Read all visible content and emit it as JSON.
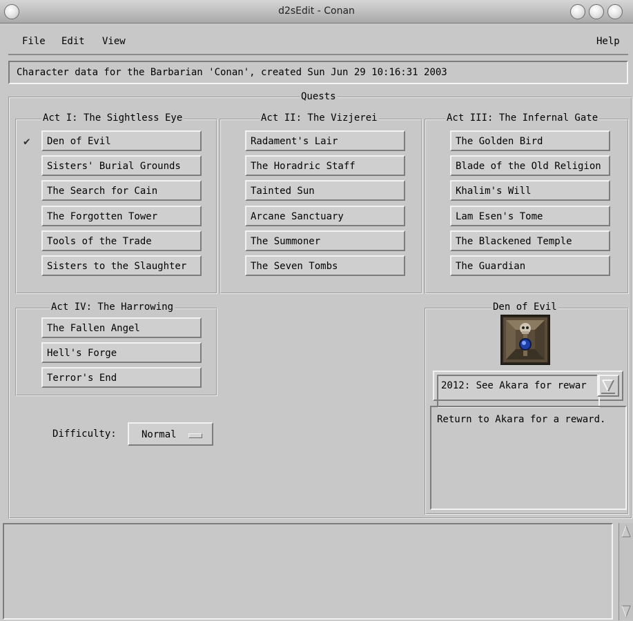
{
  "window": {
    "title": "d2sEdit - Conan"
  },
  "menu": {
    "file": "File",
    "edit": "Edit",
    "view": "View",
    "help": "Help"
  },
  "info": {
    "text": "Character data for the Barbarian 'Conan', created Sun Jun 29 10:16:31 2003"
  },
  "quests": {
    "frame_title": "Quests",
    "act1": {
      "title": "Act I: The Sightless Eye",
      "items": [
        "Den of Evil",
        "Sisters' Burial Grounds",
        "The Search for Cain",
        "The Forgotten Tower",
        "Tools of the Trade",
        "Sisters to the Slaughter"
      ],
      "completed_mark": "✔"
    },
    "act2": {
      "title": "Act II: The Vizjerei",
      "items": [
        "Radament's Lair",
        "The Horadric Staff",
        "Tainted Sun",
        "Arcane Sanctuary",
        "The Summoner",
        "The Seven Tombs"
      ]
    },
    "act3": {
      "title": "Act III: The Infernal Gate",
      "items": [
        "The Golden Bird",
        "Blade of the Old Religion",
        "Khalim's Will",
        "Lam Esen's Tome",
        "The Blackened Temple",
        "The Guardian"
      ]
    },
    "act4": {
      "title": "Act IV: The Harrowing",
      "items": [
        "The Fallen Angel",
        "Hell's Forge",
        "Terror's End"
      ]
    }
  },
  "difficulty": {
    "label": "Difficulty:",
    "value": "Normal"
  },
  "detail": {
    "title": "Den of Evil",
    "status": "2012: See Akara for rewar",
    "description": "Return to Akara for a reward."
  }
}
